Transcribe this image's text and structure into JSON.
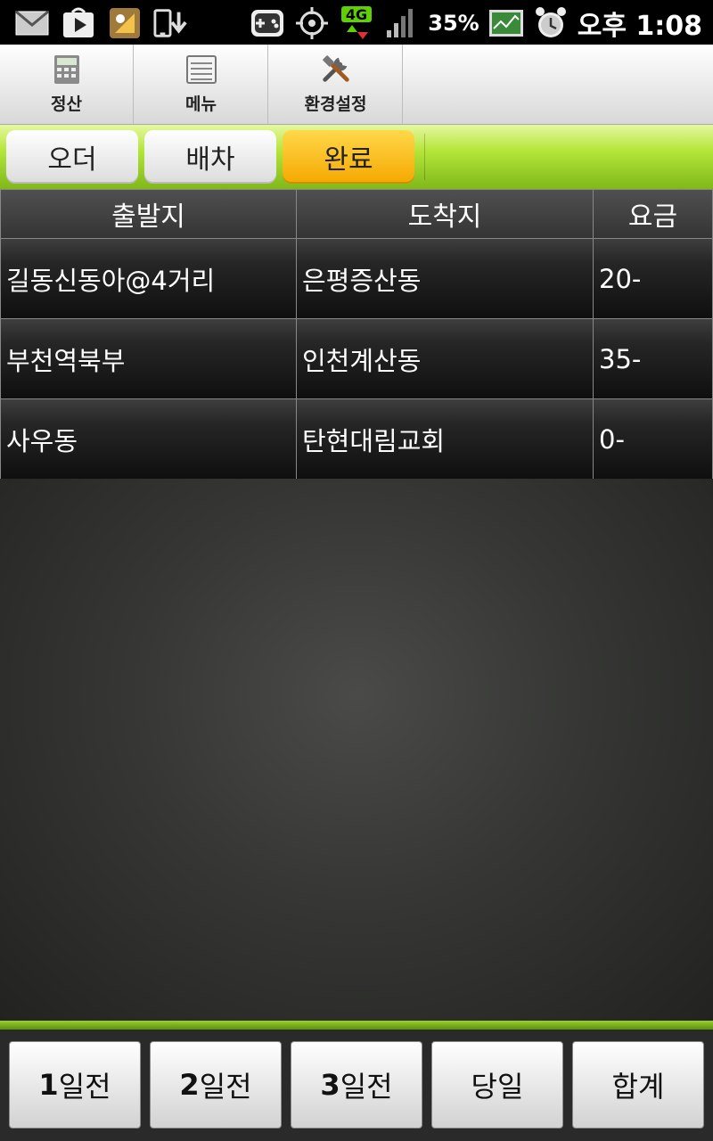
{
  "status_bar": {
    "battery": "35%",
    "ampm": "오후",
    "time": "1:08",
    "network": "4G"
  },
  "toolbar": {
    "settle_label": "정산",
    "menu_label": "메뉴",
    "settings_label": "환경설정"
  },
  "tabs": [
    {
      "label": "오더",
      "active": false
    },
    {
      "label": "배차",
      "active": false
    },
    {
      "label": "완료",
      "active": true
    }
  ],
  "table": {
    "headers": [
      "출발지",
      "도착지",
      "요금"
    ],
    "rows": [
      [
        "길동신동아@4거리",
        "은평증산동",
        "20-"
      ],
      [
        "부천역북부",
        "인천계산동",
        "35-"
      ],
      [
        "사우동",
        "탄현대림교회",
        "0-"
      ]
    ]
  },
  "bottom_buttons": [
    {
      "num": "1",
      "text": "일전"
    },
    {
      "num": "2",
      "text": "일전"
    },
    {
      "num": "3",
      "text": "일전"
    },
    {
      "num": "",
      "text": "당일"
    },
    {
      "num": "",
      "text": "합계"
    }
  ],
  "colors": {
    "accent_green": "#9ad12a",
    "active_tab": "#f5a800"
  }
}
